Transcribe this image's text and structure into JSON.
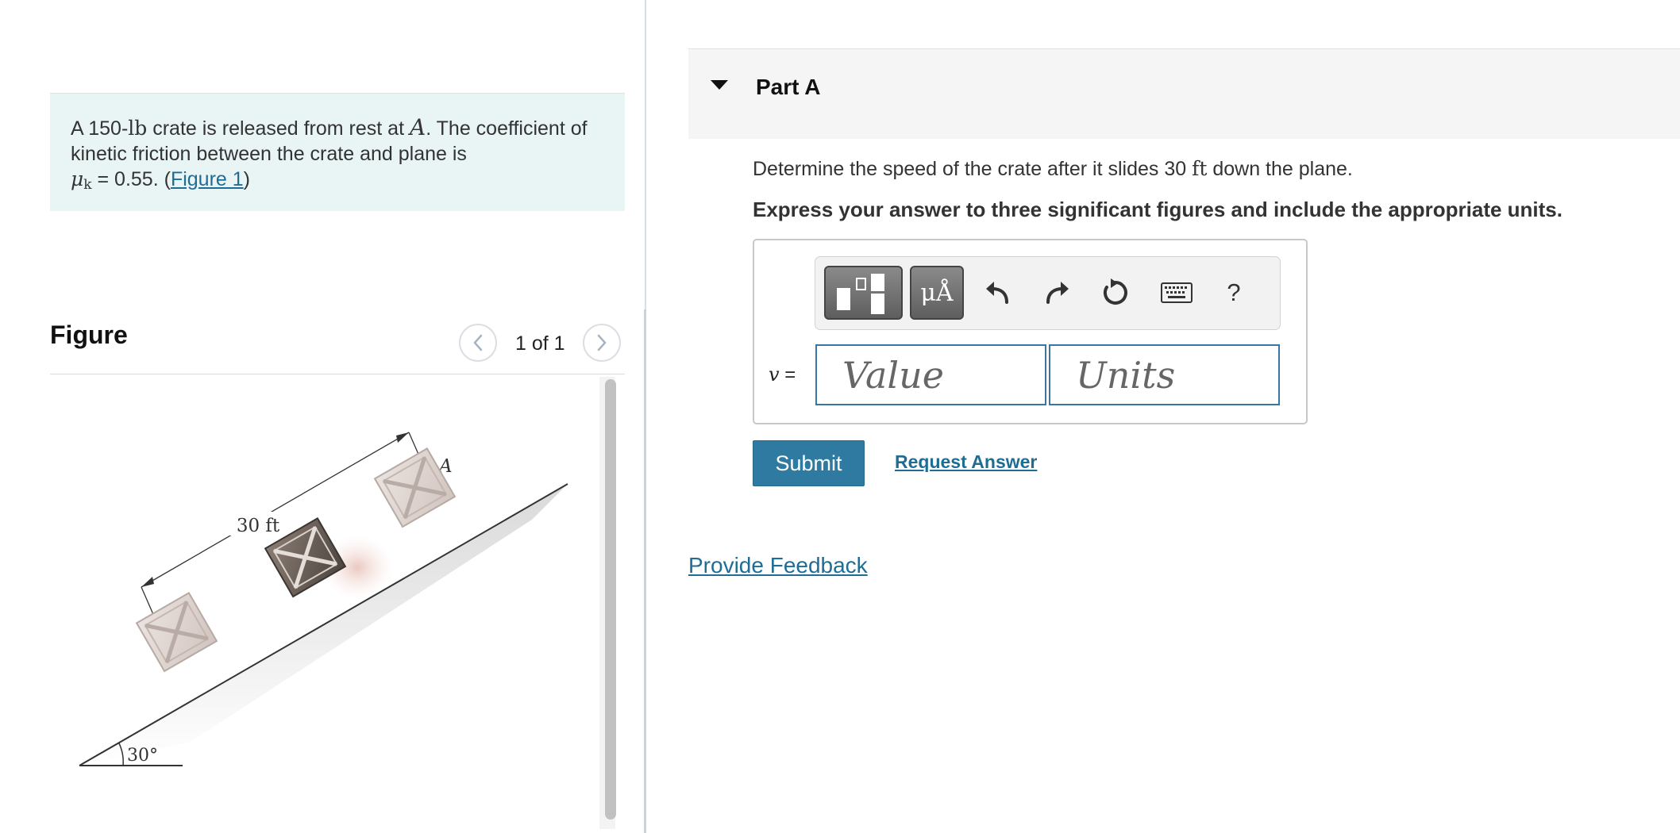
{
  "problem": {
    "text_part1": "A 150-",
    "unit_lb": "lb",
    "text_part2": " crate is released from rest at ",
    "point_a": "A",
    "text_part3": ". The coefficient of kinetic friction between the crate and plane is",
    "mu_symbol": "μ",
    "mu_subscript": "k",
    "mu_equals": " = 0.55. (",
    "figure_link": "Figure 1",
    "close_paren": ")"
  },
  "figure": {
    "title": "Figure",
    "counter": "1 of 1",
    "distance_label": "30 ft",
    "point_label": "A",
    "angle_label": "30°"
  },
  "part": {
    "title": "Part A",
    "question_pre": "Determine the speed of the crate after it slides 30 ",
    "question_unit": "ft",
    "question_post": " down the plane.",
    "instruction": "Express your answer to three significant figures and include the appropriate units."
  },
  "answer": {
    "variable": "v",
    "equals": " =",
    "value_placeholder": "Value",
    "units_placeholder": "Units",
    "units_symbol": "μÅ",
    "help_symbol": "?"
  },
  "actions": {
    "submit": "Submit",
    "request_answer": "Request Answer",
    "provide_feedback": "Provide Feedback"
  },
  "colors": {
    "accent": "#2e7aa0",
    "link": "#1f6d94",
    "problem_bg": "#e9f4f5"
  }
}
